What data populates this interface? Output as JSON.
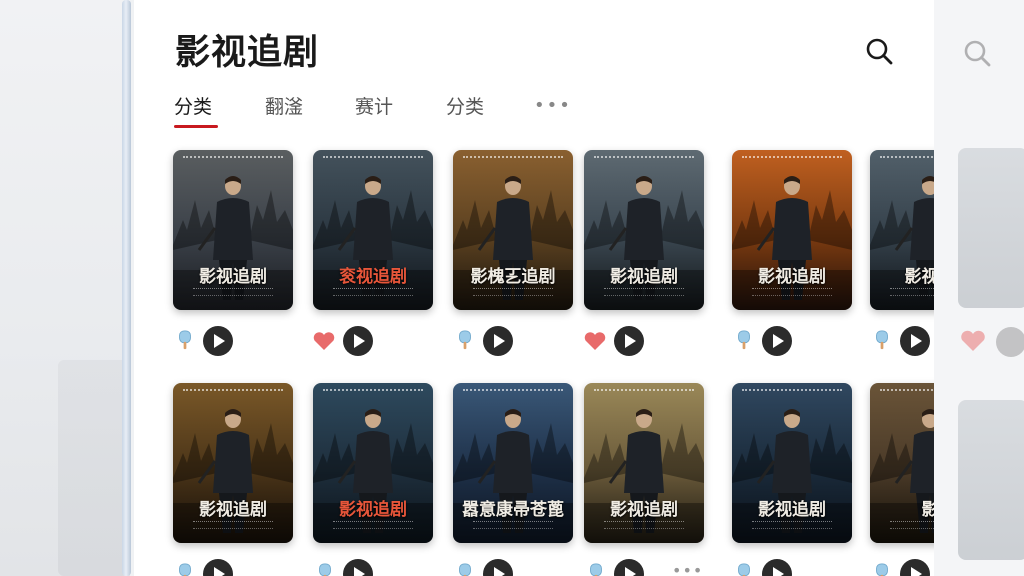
{
  "header": {
    "title": "影视追剧"
  },
  "tabs": [
    {
      "label": "分类"
    },
    {
      "label": "翻滏"
    },
    {
      "label": "赛计"
    },
    {
      "label": "分类"
    }
  ],
  "more_tabs": "•••",
  "cards_row1": [
    {
      "poster_title": "影视追剧",
      "icon": "ice-pop-icon"
    },
    {
      "poster_title": "衮视追剧",
      "icon": "heart-icon"
    },
    {
      "poster_title": "影槐㐉追剧",
      "icon": "ice-pop-icon"
    },
    {
      "poster_title": "影视追剧",
      "icon": "heart-icon"
    },
    {
      "poster_title": "影视追剧",
      "icon": "ice-pop-icon"
    },
    {
      "poster_title": "影视追",
      "icon": "ice-pop-icon"
    }
  ],
  "cards_row2": [
    {
      "poster_title": "影视追剧",
      "icon": "ice-pop-icon"
    },
    {
      "poster_title": "影视追剧",
      "icon": "ice-pop-icon"
    },
    {
      "poster_title": "嚣意康帚苍蓖",
      "icon": "ice-pop-icon"
    },
    {
      "poster_title": "影视追剧",
      "icon": "ice-pop-icon"
    },
    {
      "poster_title": "影视追剧",
      "icon": "ice-pop-icon"
    },
    {
      "poster_title": "影",
      "icon": "ice-pop-icon"
    }
  ],
  "card_more": "•••",
  "colors": {
    "accent": "#c8191f",
    "heart": "#e86a6a",
    "play": "#2b2b2b"
  }
}
